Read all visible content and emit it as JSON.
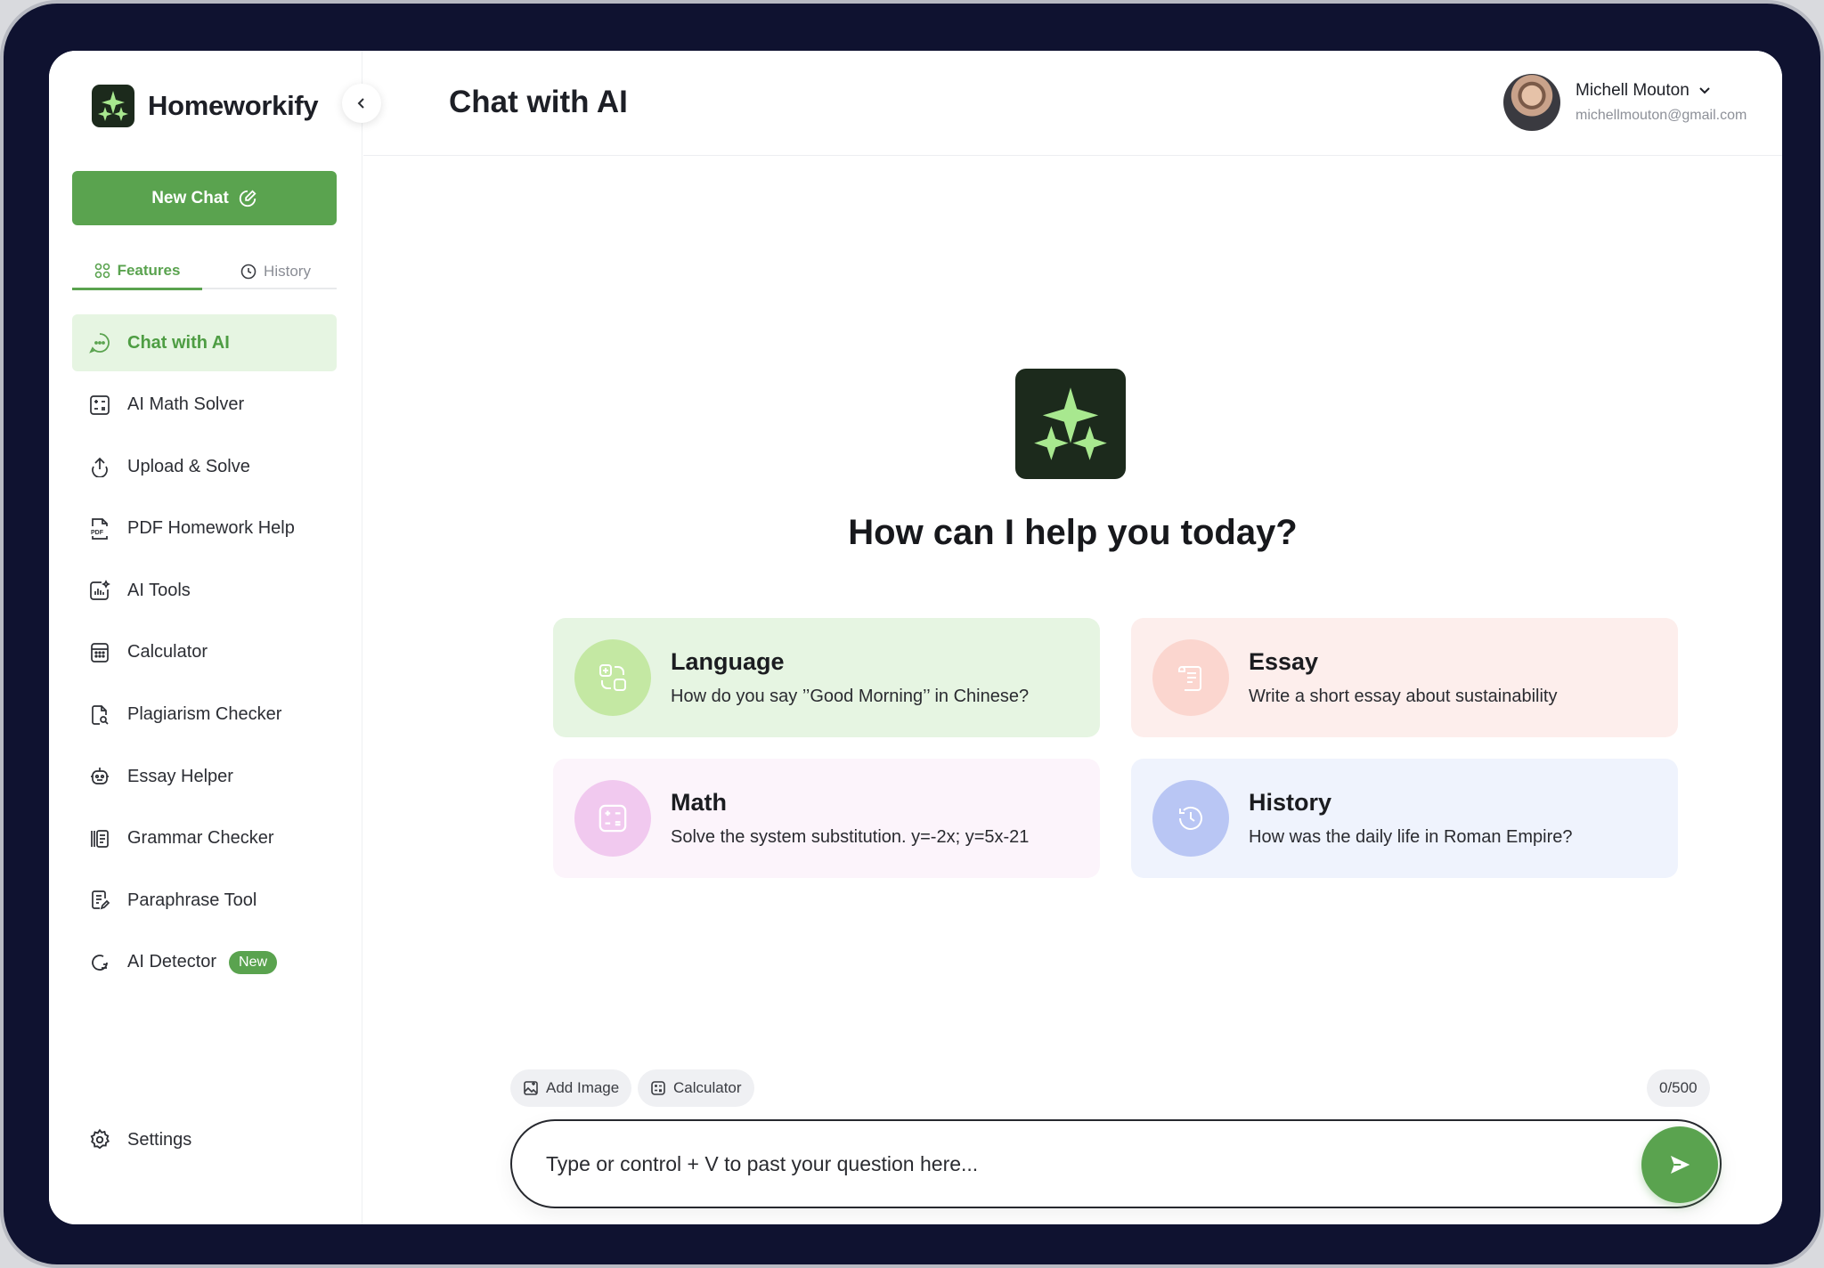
{
  "app": {
    "name": "Homeworkify"
  },
  "sidebar": {
    "new_chat_label": "New Chat",
    "tabs": [
      {
        "label": "Features",
        "icon": "grid-icon",
        "active": true
      },
      {
        "label": "History",
        "icon": "clock-icon",
        "active": false
      }
    ],
    "items": [
      {
        "label": "Chat with AI",
        "icon": "chat-icon",
        "active": true
      },
      {
        "label": "AI Math Solver",
        "icon": "math-icon"
      },
      {
        "label": "Upload & Solve",
        "icon": "upload-icon"
      },
      {
        "label": "PDF Homework Help",
        "icon": "pdf-icon"
      },
      {
        "label": "AI Tools",
        "icon": "ai-tools-icon"
      },
      {
        "label": "Calculator",
        "icon": "calculator-icon"
      },
      {
        "label": "Plagiarism Checker",
        "icon": "document-search-icon"
      },
      {
        "label": "Essay Helper",
        "icon": "robot-icon"
      },
      {
        "label": "Grammar Checker",
        "icon": "book-icon"
      },
      {
        "label": "Paraphrase Tool",
        "icon": "edit-document-icon"
      },
      {
        "label": "AI Detector",
        "icon": "detector-icon",
        "badge": "New"
      }
    ],
    "settings_label": "Settings"
  },
  "header": {
    "title": "Chat with AI",
    "user": {
      "name": "Michell Mouton",
      "email": "michellmouton@gmail.com"
    }
  },
  "main": {
    "greeting": "How can I help you today?",
    "cards": [
      {
        "title": "Language",
        "desc": "How do you say ’’Good Morning’’ in Chinese?",
        "icon": "translate-icon"
      },
      {
        "title": "Essay",
        "desc": "Write a short essay about sustainability",
        "icon": "scroll-icon"
      },
      {
        "title": "Math",
        "desc": "Solve the system substitution. y=-2x; y=5x-21",
        "icon": "math-icon"
      },
      {
        "title": "History",
        "desc": "How was the daily life in Roman Empire?",
        "icon": "history-icon"
      }
    ],
    "composer": {
      "add_image_label": "Add Image",
      "calculator_label": "Calculator",
      "counter": "0/500",
      "placeholder": "Type or control + V to past your question here..."
    }
  },
  "colors": {
    "brand_green": "#5aa34f",
    "logo_bg": "#1c2a1c",
    "logo_star": "#a8e88f"
  }
}
